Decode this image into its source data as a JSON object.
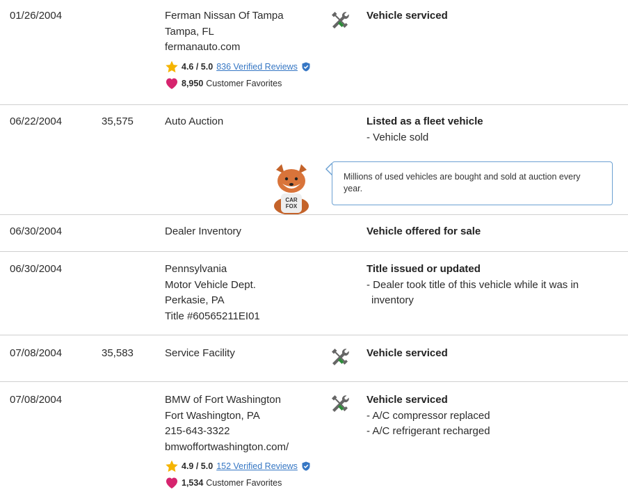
{
  "records": [
    {
      "date": "01/26/2004",
      "odometer": "",
      "source_lines": [
        "Ferman Nissan Of Tampa",
        "Tampa, FL",
        "fermanauto.com"
      ],
      "rating": {
        "score": "4.6 / 5.0",
        "reviews": "836 Verified Reviews"
      },
      "favorites": {
        "count": "8,950",
        "label": "Customer Favorites"
      },
      "icon": "wrench-screwdriver-icon",
      "comment_head": "Vehicle serviced",
      "comment_details": []
    },
    {
      "date": "06/22/2004",
      "odometer": "35,575",
      "source_lines": [
        "Auto Auction"
      ],
      "icon": "",
      "comment_head": "Listed as a fleet vehicle",
      "comment_details": [
        "- Vehicle sold"
      ],
      "tooltip": "Millions of used vehicles are bought and sold at auction every year."
    },
    {
      "date": "06/30/2004",
      "odometer": "",
      "source_lines": [
        "Dealer Inventory"
      ],
      "icon": "",
      "comment_head": "Vehicle offered for sale",
      "comment_details": []
    },
    {
      "date": "06/30/2004",
      "odometer": "",
      "source_lines": [
        "Pennsylvania",
        "Motor Vehicle Dept.",
        "Perkasie, PA",
        "Title #60565211EI01"
      ],
      "icon": "",
      "comment_head": "Title issued or updated",
      "comment_details": [
        "- Dealer took title of this vehicle while it was in inventory"
      ]
    },
    {
      "date": "07/08/2004",
      "odometer": "35,583",
      "source_lines": [
        "Service Facility"
      ],
      "icon": "wrench-screwdriver-icon",
      "comment_head": "Vehicle serviced",
      "comment_details": []
    },
    {
      "date": "07/08/2004",
      "odometer": "",
      "source_lines": [
        "BMW of Fort Washington",
        "Fort Washington, PA",
        "215-643-3322",
        "bmwoffortwashington.com/"
      ],
      "rating": {
        "score": "4.9 / 5.0",
        "reviews": "152 Verified Reviews"
      },
      "favorites": {
        "count": "1,534",
        "label": "Customer Favorites"
      },
      "icon": "wrench-screwdriver-icon",
      "comment_head": "Vehicle serviced",
      "comment_details": [
        "- A/C compressor replaced",
        "- A/C refrigerant recharged"
      ]
    }
  ],
  "mascot": {
    "shirt_text": [
      "CAR",
      "FOX"
    ]
  },
  "colors": {
    "star": "#f5b400",
    "heart": "#d6246e",
    "link": "#3677c4",
    "verified": "#3677c4",
    "tooltip_border": "#6ba0d2",
    "divider": "#cfcfcf",
    "icon_gray": "#666666",
    "icon_green": "#2e8b3a"
  }
}
